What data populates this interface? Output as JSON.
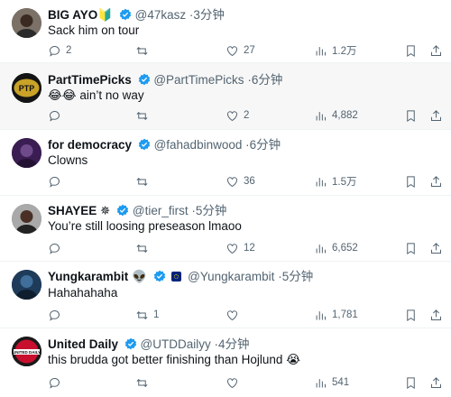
{
  "tweets": [
    {
      "name": "BIG AYO",
      "badge": "🔰",
      "handle": "@47kasz",
      "time": "3分钟",
      "text": "Sack him on tour",
      "reply_count": "2",
      "retweet_count": "",
      "like_count": "27",
      "view_count": "1.2万",
      "verified": true
    },
    {
      "name": "PartTimePicks",
      "handle": "@PartTimePicks",
      "time": "6分钟",
      "emoji": "😂😂",
      "text": " ain’t no way",
      "reply_count": "",
      "retweet_count": "",
      "like_count": "2",
      "view_count": "4,882",
      "verified": true,
      "avatar_text": "PTP"
    },
    {
      "name": "for democracy",
      "handle": "@fahadbinwood",
      "time": "6分钟",
      "text": "Clowns",
      "reply_count": "",
      "retweet_count": "",
      "like_count": "36",
      "view_count": "1.5万",
      "verified": true
    },
    {
      "name": "SHAYEE",
      "badge": "✵",
      "handle": "@tier_first",
      "time": "5分钟",
      "text": "You’re still loosing preseason lmaoo",
      "reply_count": "",
      "retweet_count": "",
      "like_count": "12",
      "view_count": "6,652",
      "verified": true
    },
    {
      "name": "Yungkarambit",
      "badge": "👽",
      "handle": "@Yungkarambit",
      "time": "5分钟",
      "text": "Hahahahaha",
      "reply_count": "",
      "retweet_count": "1",
      "like_count": "",
      "view_count": "1,781",
      "verified": true
    },
    {
      "name": "United Daily",
      "handle": "@UTDDailyy",
      "time": "4分钟",
      "text": "this brudda got better finishing than Hojlund ",
      "emoji_after": "😭",
      "reply_count": "",
      "retweet_count": "",
      "like_count": "",
      "view_count": "541",
      "verified": true,
      "avatar_text": "UNITED DAILY"
    }
  ],
  "meta_separator": "·",
  "colors": {
    "verified": "#1d9bf0",
    "secondary_text": "#536471",
    "primary_text": "#0f1419",
    "highlight_bg": "#f7f7f7"
  },
  "icons": [
    "reply-icon",
    "retweet-icon",
    "like-icon",
    "views-icon",
    "bookmark-icon",
    "share-icon",
    "verified-badge-icon",
    "flag-icon"
  ]
}
